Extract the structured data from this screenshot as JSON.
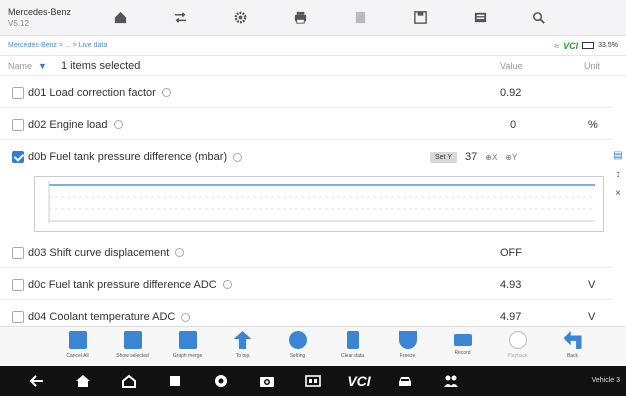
{
  "header": {
    "brand_line1": "Mercedes-Benz",
    "brand_line2": "V5.12",
    "icons": [
      "home-icon",
      "vehicle-swap-icon",
      "settings-icon",
      "print-icon",
      "help-icon",
      "save-icon",
      "data-icon",
      "search-icon"
    ]
  },
  "breadcrumb": "Mercedes-Benz > ... > Live data",
  "status": {
    "vci": "VCI",
    "percent": "33.5%"
  },
  "list_header": {
    "name_col": "Name",
    "selected_text": "1 items selected",
    "value_col": "Value",
    "unit_col": "Unit"
  },
  "rows": [
    {
      "label": "d01 Load correction factor",
      "value": "0.92",
      "unit": "",
      "checked": false
    },
    {
      "label": "d02 Engine load",
      "value": "0",
      "unit": "%",
      "checked": false
    },
    {
      "label": "d0b Fuel tank pressure difference   (mbar)",
      "value": "37",
      "unit": "",
      "checked": true,
      "set_label": "Set Y",
      "zoom_x": "X",
      "zoom_y": "Y"
    },
    {
      "label": "d03 Shift curve displacement",
      "value": "OFF",
      "unit": "",
      "checked": false
    },
    {
      "label": "d0c Fuel tank pressure difference ADC",
      "value": "4.93",
      "unit": "V",
      "checked": false
    },
    {
      "label": "d04 Coolant temperature ADC",
      "value": "4.97",
      "unit": "V",
      "checked": false
    }
  ],
  "toolbar": [
    {
      "label": "Cancel All",
      "icon": "cancel-all-icon"
    },
    {
      "label": "Show selected",
      "icon": "show-selected-icon"
    },
    {
      "label": "Graph merge",
      "icon": "graph-merge-icon"
    },
    {
      "label": "To top",
      "icon": "to-top-icon"
    },
    {
      "label": "Setting",
      "icon": "setting-icon"
    },
    {
      "label": "Clear data",
      "icon": "clear-data-icon"
    },
    {
      "label": "Freeze",
      "icon": "freeze-icon"
    },
    {
      "label": "Record",
      "icon": "record-icon"
    },
    {
      "label": "Playback",
      "icon": "playback-icon"
    },
    {
      "label": "Back",
      "icon": "back-icon"
    }
  ],
  "nav_status": "Vehicle 3"
}
